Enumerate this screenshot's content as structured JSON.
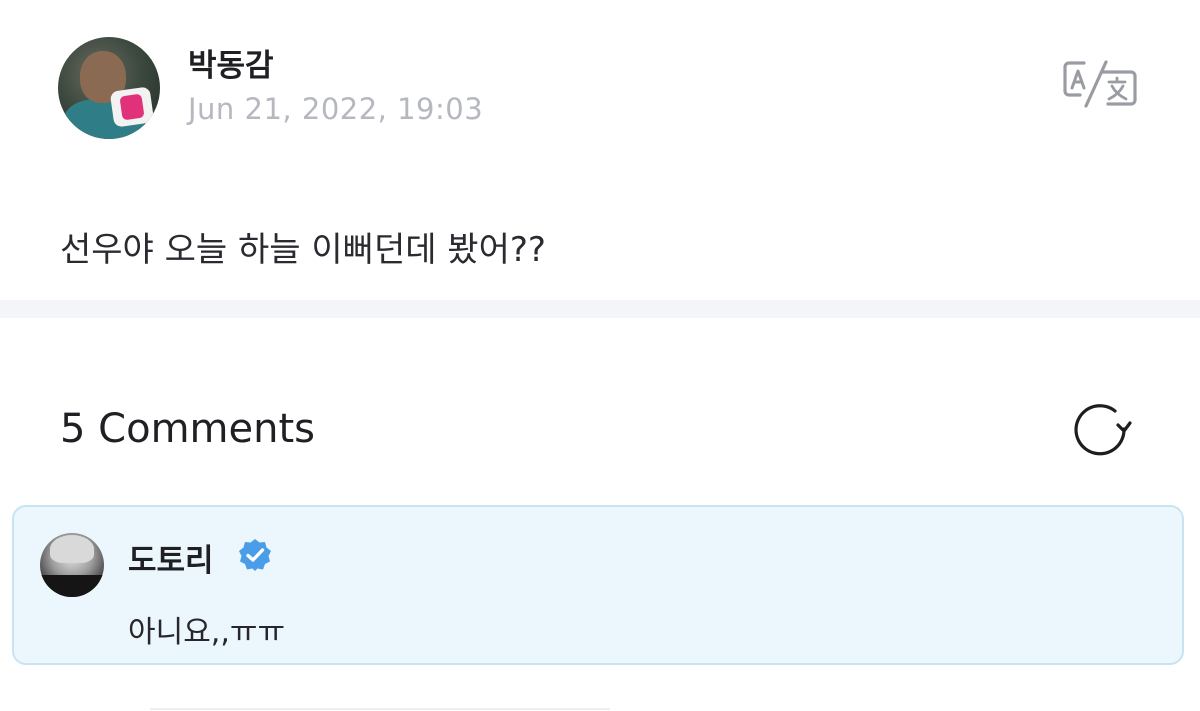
{
  "post": {
    "author": "박동감",
    "timestamp": "Jun 21, 2022, 19:03",
    "body": "선우야 오늘 하늘 이뻐던데 봤어??",
    "translate_icon": "translate-icon"
  },
  "comments": {
    "count_label": "5 Comments",
    "refresh_icon": "refresh-icon",
    "items": [
      {
        "author": "도토리",
        "verified": true,
        "text": "아니요,,ㅠㅠ"
      }
    ]
  },
  "colors": {
    "timestamp": "#b6b8c0",
    "highlight_bg": "#ecf7fd",
    "highlight_border": "#c8e4f4",
    "verified": "#4a9de8"
  }
}
